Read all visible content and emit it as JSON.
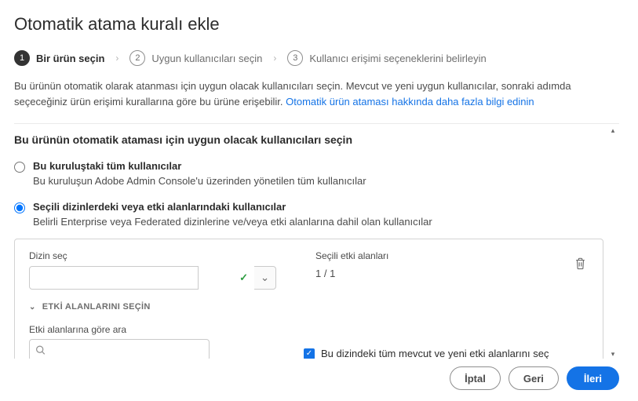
{
  "title": "Otomatik atama kuralı ekle",
  "stepper": {
    "steps": [
      {
        "num": "1",
        "label": "Bir ürün seçin",
        "active": true
      },
      {
        "num": "2",
        "label": "Uygun kullanıcıları seçin",
        "active": false
      },
      {
        "num": "3",
        "label": "Kullanıcı erişimi seçeneklerini belirleyin",
        "active": false
      }
    ],
    "sep": "›"
  },
  "intro": {
    "text": "Bu ürünün otomatik olarak atanması için uygun olacak kullanıcıları seçin. Mevcut ve yeni uygun kullanıcılar, sonraki adımda seçeceğiniz ürün erişimi kurallarına göre bu ürüne erişebilir.  ",
    "link": "Otomatik ürün ataması hakkında daha fazla bilgi edinin"
  },
  "section_heading": "Bu ürünün otomatik ataması için uygun olacak kullanıcıları seçin",
  "radios": {
    "opt1": {
      "title": "Bu kuruluştaki tüm kullanıcılar",
      "desc": "Bu kuruluşun Adobe Admin Console'u üzerinden yönetilen tüm kullanıcılar"
    },
    "opt2": {
      "title": "Seçili dizinlerdeki veya etki alanlarındaki kullanıcılar",
      "desc": "Belirli Enterprise veya Federated dizinlerine ve/veya etki alanlarına dahil olan kullanıcılar"
    }
  },
  "config": {
    "dir_label": "Dizin seç",
    "dir_value": "",
    "selected_label": "Seçili etki alanları",
    "selected_value": "1 / 1",
    "disclosure": "ETKİ ALANLARINI SEÇİN",
    "search_label": "Etki alanlarına göre ara",
    "search_placeholder": "",
    "checkbox_label": "Bu dizindeki tüm mevcut ve yeni etki alanlarını seç"
  },
  "footer": {
    "cancel": "İptal",
    "back": "Geri",
    "next": "İleri"
  }
}
